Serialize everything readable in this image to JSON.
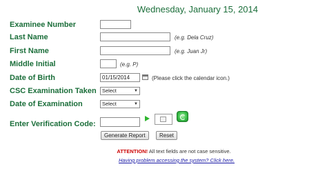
{
  "header": {
    "date": "Wednesday, January 15, 2014"
  },
  "form": {
    "examinee_number_label": "Examinee Number",
    "last_name_label": "Last Name",
    "last_name_hint": "(e.g. Dela Cruz)",
    "first_name_label": "First Name",
    "first_name_hint": "(e.g. Juan Jr)",
    "middle_initial_label": "Middle Initial",
    "middle_initial_hint": "(e.g. P)",
    "dob_label": "Date of Birth",
    "dob_value": "01/15/2014",
    "dob_hint": "(Please click the calendar icon.)",
    "exam_taken_label": "CSC Examination Taken",
    "exam_taken_value": "Select",
    "exam_date_label": "Date of Examination",
    "exam_date_value": "Select",
    "verification_label": "Enter Verification Code:",
    "generate_button": "Generate Report",
    "reset_button": "Reset"
  },
  "notice": {
    "attention_word": "ATTENTION!",
    "attention_text": " All text fields are not case sensitive.",
    "help_link": "Having problem accessing the system? Click here."
  },
  "colors": {
    "label_green": "#1b6e3a",
    "attention_red": "#cc0000",
    "link_blue": "#1a1aa6"
  }
}
